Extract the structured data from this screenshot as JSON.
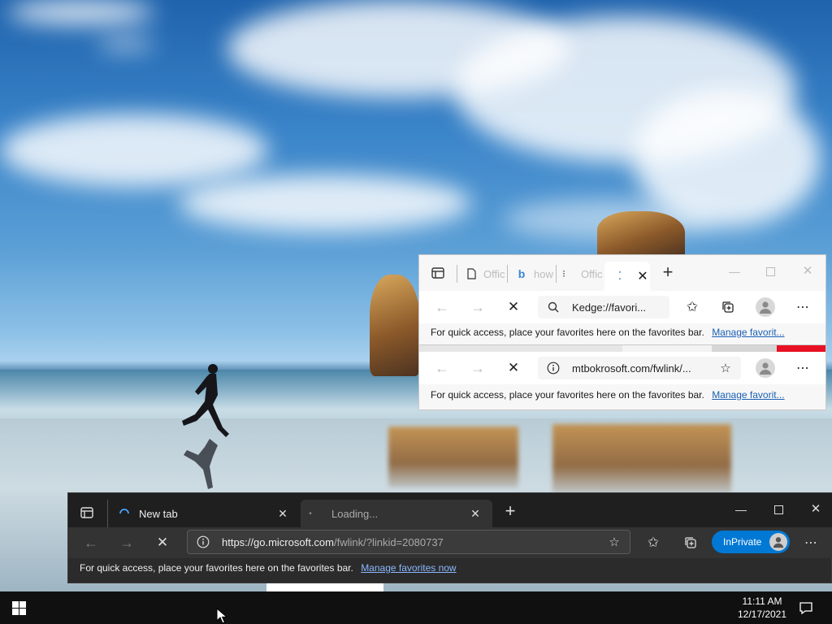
{
  "colors": {
    "accent_blue": "#0078d4",
    "taskbar": "#101010",
    "dark_window": "#2b2b2b",
    "red_bar": "#e81123"
  },
  "win1": {
    "tabs": [
      {
        "icon": "page-icon",
        "label": "Offic"
      },
      {
        "icon": "bing-icon",
        "label": "how"
      },
      {
        "icon": "loading-icon",
        "label": "Offic"
      },
      {
        "icon": "loading-icon",
        "label": ""
      }
    ],
    "address": "Kedge://favori...",
    "favbar_text": "For quick access, place your favorites here on the favorites bar.",
    "favbar_link": "Manage favorit..."
  },
  "win2": {
    "address": "mtbokrosoft.com/fwlink/...",
    "favbar_text": "For quick access, place your favorites here on the favorites bar.",
    "favbar_link": "Manage favorit..."
  },
  "win3": {
    "tabs": [
      {
        "label": "New tab"
      },
      {
        "label": "Loading..."
      }
    ],
    "address_host": "https://go.microsoft.com",
    "address_path": "/fwlink/?linkid=2080737",
    "inprivate_label": "InPrivate",
    "favbar_text": "For quick access, place your favorites here on the favorites bar.",
    "favbar_link": "Manage favorites now"
  },
  "taskbar": {
    "time": "11:11 AM",
    "date": "12/17/2021"
  }
}
